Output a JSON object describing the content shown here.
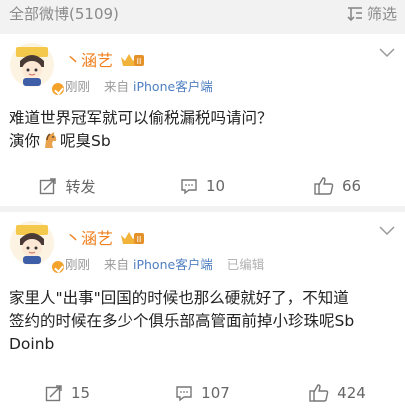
{
  "header": {
    "all_weibo_label": "全部微博(5109)",
    "filter_label": "筛选",
    "filter_icon": "filter-icon"
  },
  "posts": [
    {
      "username": "丶涵艺",
      "time": "刚刚",
      "from_prefix": "来自",
      "source": "iPhone客户端",
      "edited": "",
      "lines": [
        "难道世界冠军就可以偷税漏税吗请问？"
      ],
      "line2_prefix": "演你",
      "line2_suffix": "呢臭Sb",
      "repost_label": "转发",
      "comments": "10",
      "likes": "66"
    },
    {
      "username": "丶涵艺",
      "time": "刚刚",
      "from_prefix": "来自",
      "source": "iPhone客户端",
      "edited": "已编辑",
      "lines": [
        "家里人\"出事\"回国的时候也那么硬就好了，不知道",
        "签约的时候在多少个俱乐部高管面前掉小珍珠呢Sb",
        "Doinb"
      ],
      "reposts": "15",
      "comments": "107",
      "likes": "424"
    }
  ],
  "colors": {
    "username": "#f07f1f",
    "source_link": "#4f7fc0",
    "meta_gray": "#9a9a9a",
    "background": "#f2f2f2"
  }
}
